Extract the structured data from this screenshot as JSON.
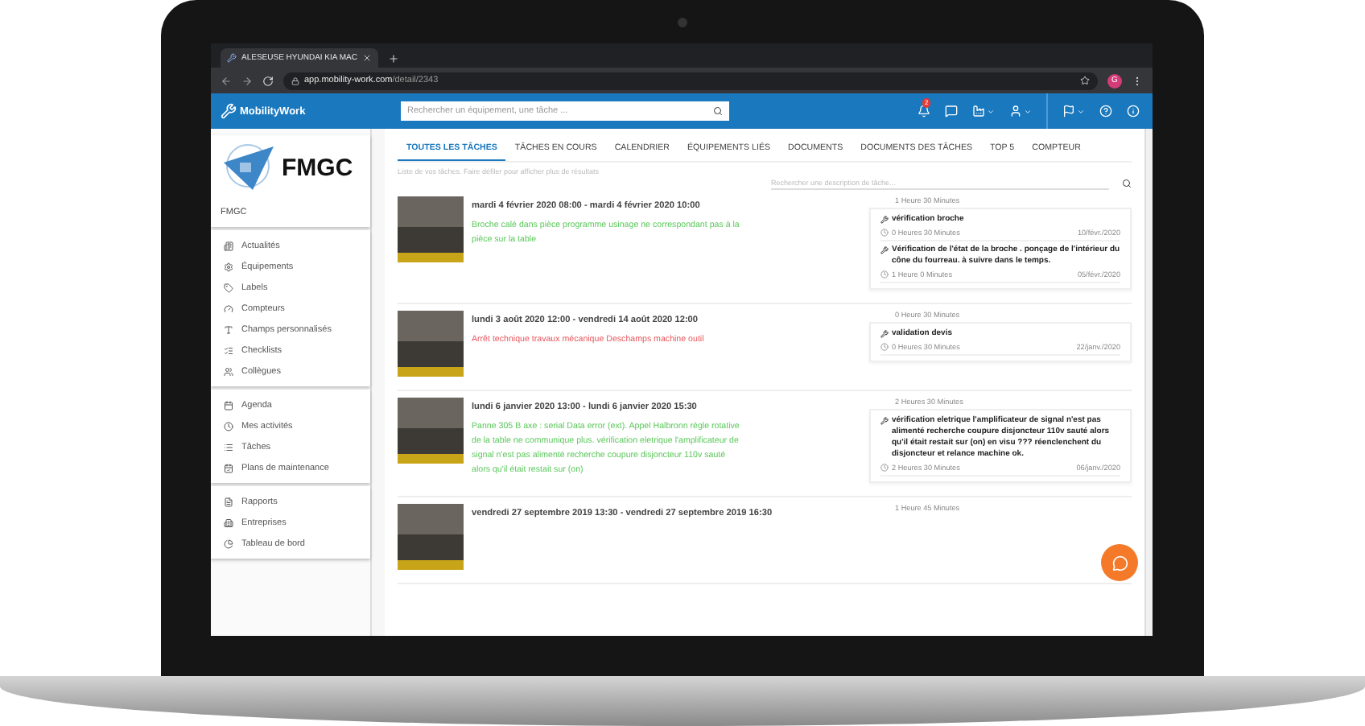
{
  "browser": {
    "tab_title": "ALESEUSE HYUNDAI KIA MAC",
    "url_host": "app.mobility-work.com",
    "url_path": "/detail/2343",
    "profile_initial": "G"
  },
  "app_header": {
    "logo": "MobilityWork",
    "search": {
      "placeholder": "Rechercher un équipement, une tâche ..."
    },
    "notification_count": "2"
  },
  "sidebar": {
    "logo_text": "FMGC",
    "company": "FMGC",
    "groups": [
      {
        "items": [
          "Actualités",
          "Équipements",
          "Labels",
          "Compteurs",
          "Champs personnalisés",
          "Checklists",
          "Collègues"
        ]
      },
      {
        "items": [
          "Agenda",
          "Mes activités",
          "Tâches",
          "Plans de maintenance"
        ]
      },
      {
        "items": [
          "Rapports",
          "Entreprises",
          "Tableau de bord"
        ]
      }
    ]
  },
  "tabs": [
    {
      "label": "TOUTES LES TÂCHES",
      "selected": true
    },
    {
      "label": "TÂCHES EN COURS",
      "selected": false
    },
    {
      "label": "CALENDRIER",
      "selected": false
    },
    {
      "label": "ÉQUIPEMENTS LIÉS",
      "selected": false
    },
    {
      "label": "DOCUMENTS",
      "selected": false
    },
    {
      "label": "DOCUMENTS DES TÂCHES",
      "selected": false
    },
    {
      "label": "TOP 5",
      "selected": false
    },
    {
      "label": "COMPTEUR",
      "selected": false
    }
  ],
  "list_hint": "Liste de vos tâches. Faire défiler pour afficher plus de résultats",
  "task_search": {
    "placeholder": "Rechercher une description de tâche..."
  },
  "tasks": [
    {
      "period": "mardi 4 février 2020 08:00 - mardi 4 février 2020 10:00",
      "description": "Broche calé dans pièce programme usinage ne correspondant pas à la pièce sur la table",
      "color": "#5cc85c",
      "total": "1 Heure 30 Minutes",
      "subtasks": [
        {
          "title": "vérification broche",
          "duration": "0 Heures 30 Minutes",
          "date": "10/févr./2020"
        },
        {
          "title": "Vérification de l'état de la broche . ponçage de l'intérieur du cône du fourreau. à suivre dans le temps.",
          "duration": "1 Heure 0 Minutes",
          "date": "05/févr./2020"
        }
      ]
    },
    {
      "period": "lundi 3 août 2020 12:00 - vendredi 14 août 2020 12:00",
      "description": "Arrêt technique travaux mécanique Deschamps machine outil",
      "color": "#e8585e",
      "total": "0 Heure 30 Minutes",
      "subtasks": [
        {
          "title": "validation devis",
          "duration": "0 Heures 30 Minutes",
          "date": "22/janv./2020"
        }
      ]
    },
    {
      "period": "lundi 6 janvier 2020 13:00 - lundi 6 janvier 2020 15:30",
      "description": "Panne 305 B axe : serial Data error (ext). Appel Halbronn règle rotative de la table ne communique plus. vérification eletrique l'amplificateur de signal n'est pas alimenté recherche coupure disjoncteur 110v sauté alors qu'il était restait sur (on)",
      "color": "#5cc85c",
      "total": "2 Heures 30 Minutes",
      "subtasks": [
        {
          "title": "vérification eletrique l'amplificateur de signal n'est pas alimenté recherche coupure disjoncteur 110v sauté alors qu'il était restait sur (on) en visu ??? réenclenchent du disjoncteur et relance machine ok.",
          "duration": "2 Heures 30 Minutes",
          "date": "06/janv./2020"
        }
      ]
    },
    {
      "period": "vendredi 27 septembre 2019 13:30 - vendredi 27 septembre 2019 16:30",
      "total": "1 Heure 45 Minutes"
    }
  ]
}
